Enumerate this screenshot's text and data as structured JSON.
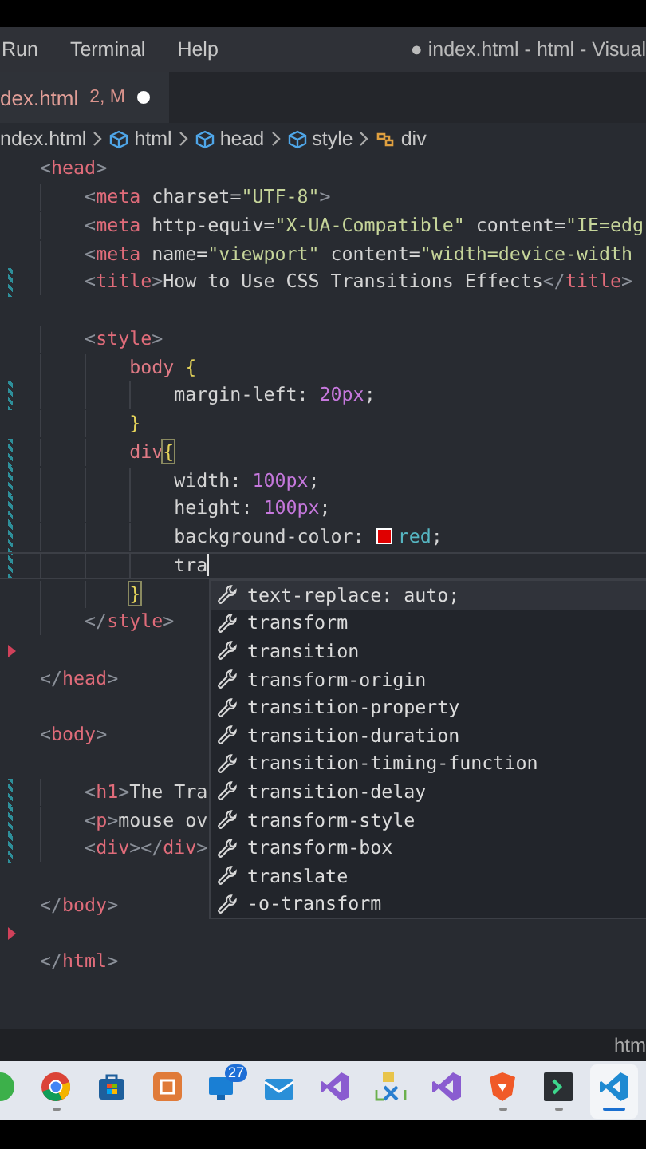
{
  "menu_bar": {
    "items": [
      "Run",
      "Terminal",
      "Help"
    ],
    "title": "● index.html - html - Visual"
  },
  "tabs": [
    {
      "label": "dex.html",
      "problems": "2, M",
      "dirty": true,
      "selected": true
    }
  ],
  "breadcrumbs": [
    {
      "kind": "file",
      "label": "ndex.html"
    },
    {
      "kind": "element",
      "label": "html"
    },
    {
      "kind": "element",
      "label": "head"
    },
    {
      "kind": "element",
      "label": "style"
    },
    {
      "kind": "selector",
      "label": "div"
    }
  ],
  "editor": {
    "lines": [
      {
        "text": "<head>",
        "modified": false,
        "deleted": false,
        "active": false
      },
      {
        "text": "    <meta charset=\"UTF-8\">",
        "modified": false,
        "deleted": false,
        "active": false
      },
      {
        "text": "    <meta http-equiv=\"X-UA-Compatible\" content=\"IE=edg",
        "modified": false,
        "deleted": false,
        "active": false
      },
      {
        "text": "    <meta name=\"viewport\" content=\"width=device-width",
        "modified": false,
        "deleted": false,
        "active": false
      },
      {
        "text": "    <title>How to Use CSS Transitions Effects</title>",
        "modified": true,
        "deleted": false,
        "active": false
      },
      {
        "modified": false,
        "deleted": false,
        "active": false
      },
      {
        "text": "    <style>",
        "modified": false,
        "deleted": false,
        "active": false
      },
      {
        "text": "        body {",
        "modified": false,
        "deleted": false,
        "active": false,
        "bracket_match": false
      },
      {
        "text": "            margin-left: 20px;",
        "modified": true,
        "deleted": false,
        "active": false
      },
      {
        "text": "        }",
        "modified": false,
        "deleted": false,
        "active": false,
        "bracket_match": false
      },
      {
        "text": "        div{",
        "modified": true,
        "deleted": false,
        "active": false,
        "bracket_match": true
      },
      {
        "text": "            width: 100px;",
        "modified": true,
        "deleted": false,
        "active": false
      },
      {
        "text": "            height: 100px;",
        "modified": true,
        "deleted": false,
        "active": false
      },
      {
        "text": "            background-color: red;",
        "modified": true,
        "deleted": false,
        "active": false
      },
      {
        "text": "            tra",
        "modified": true,
        "deleted": false,
        "active": true
      },
      {
        "text": "        }",
        "modified": false,
        "deleted": false,
        "active": false,
        "bracket_match": true
      },
      {
        "text": "    </style>",
        "modified": false,
        "deleted": false,
        "active": false
      },
      {
        "modified": false,
        "deleted": true,
        "active": false
      },
      {
        "text": "</head>",
        "modified": false,
        "deleted": false,
        "active": false
      },
      {
        "modified": false,
        "deleted": false,
        "active": false
      },
      {
        "text": "<body>",
        "modified": false,
        "deleted": false,
        "active": false
      },
      {
        "modified": false,
        "deleted": false,
        "active": false
      },
      {
        "text": "    <h1>The Tra",
        "modified": true,
        "deleted": false,
        "active": false
      },
      {
        "text": "    <p>mouse ov",
        "modified": true,
        "deleted": false,
        "active": false
      },
      {
        "text": "    <div></div>",
        "modified": true,
        "deleted": false,
        "active": false
      },
      {
        "modified": false,
        "deleted": false,
        "active": false
      },
      {
        "text": "</body>",
        "modified": false,
        "deleted": false,
        "active": false
      },
      {
        "modified": false,
        "deleted": true,
        "active": false
      },
      {
        "text": "</html>",
        "modified": false,
        "deleted": false,
        "active": false
      }
    ]
  },
  "suggestions": [
    {
      "label": "text-replace: auto;",
      "selected": true
    },
    {
      "label": "transform",
      "selected": false
    },
    {
      "label": "transition",
      "selected": false
    },
    {
      "label": "transform-origin",
      "selected": false
    },
    {
      "label": "transition-property",
      "selected": false
    },
    {
      "label": "transition-duration",
      "selected": false
    },
    {
      "label": "transition-timing-function",
      "selected": false
    },
    {
      "label": "transition-delay",
      "selected": false
    },
    {
      "label": "transform-style",
      "selected": false
    },
    {
      "label": "transform-box",
      "selected": false
    },
    {
      "label": "translate",
      "selected": false
    },
    {
      "label": "-o-transform",
      "selected": false
    }
  ],
  "status_bar": {
    "right": "htm"
  },
  "taskbar": {
    "apps": [
      {
        "kind": "green",
        "running": false,
        "selected": false
      },
      {
        "kind": "wheel",
        "running": true,
        "selected": false
      },
      {
        "kind": "bag",
        "running": false,
        "selected": false
      },
      {
        "kind": "orange",
        "running": false,
        "selected": false
      },
      {
        "kind": "monitor",
        "running": false,
        "selected": false,
        "badge": "27"
      },
      {
        "kind": "mail",
        "running": false,
        "selected": false
      },
      {
        "kind": "ribbon",
        "running": false,
        "selected": false
      },
      {
        "kind": "tools",
        "running": false,
        "selected": false
      },
      {
        "kind": "ribbon",
        "running": false,
        "selected": false
      },
      {
        "kind": "shield",
        "running": true,
        "selected": false
      },
      {
        "kind": "terminal",
        "running": true,
        "selected": false
      },
      {
        "kind": "editor",
        "running": true,
        "selected": true
      }
    ]
  }
}
